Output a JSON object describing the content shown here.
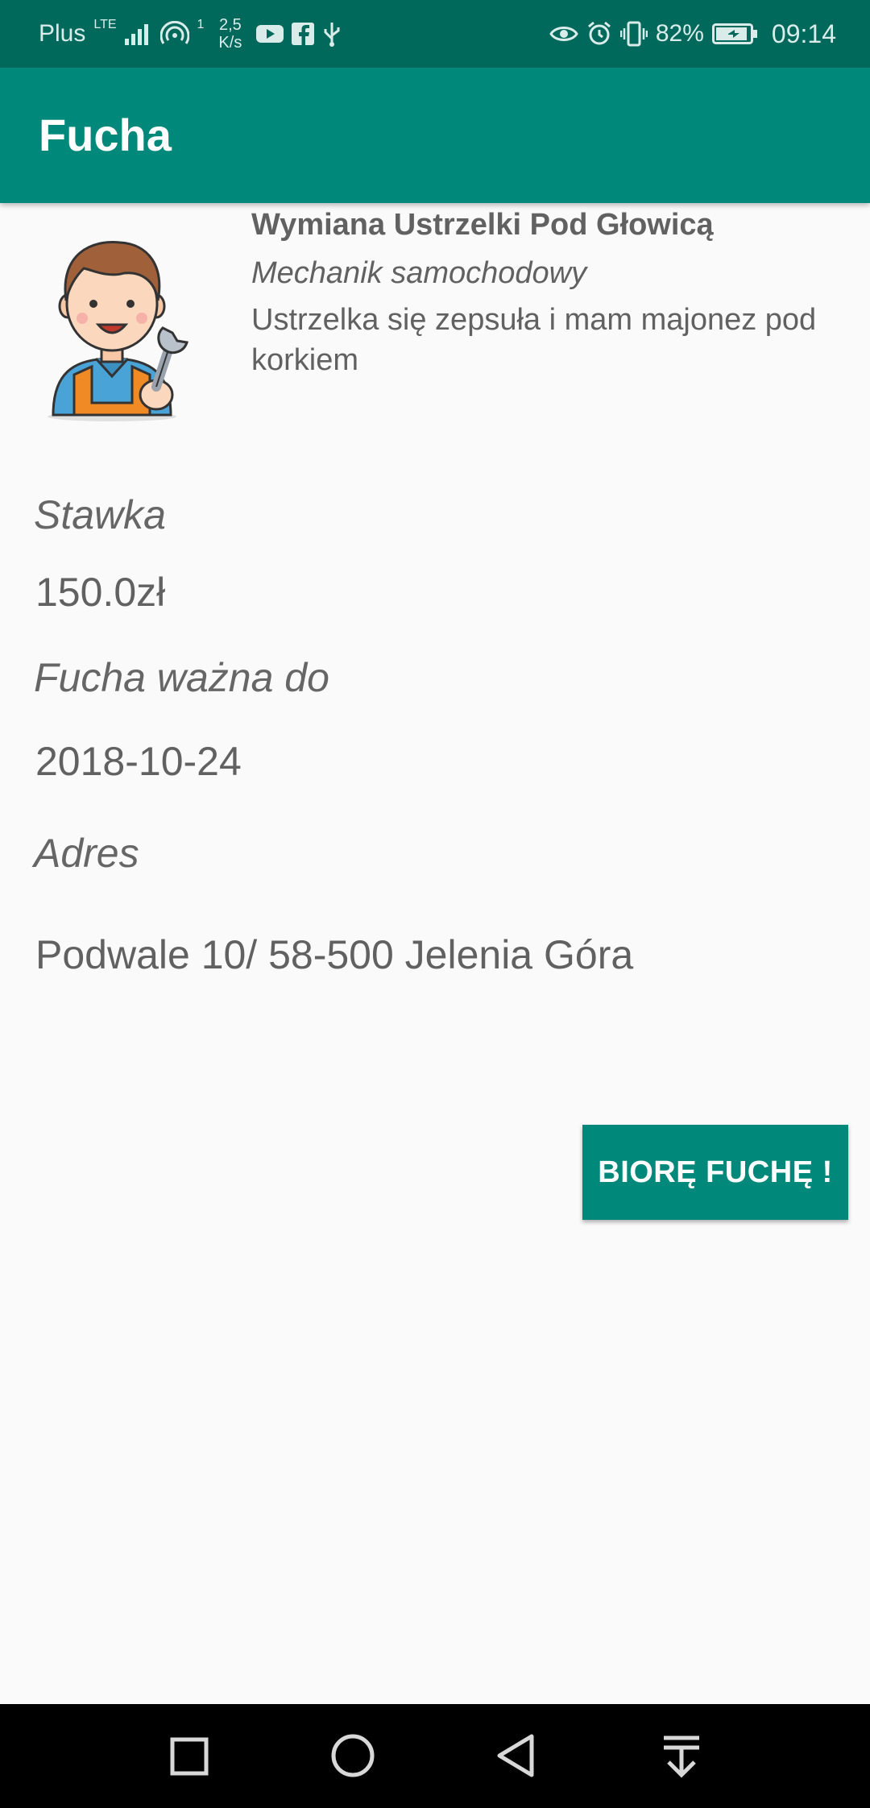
{
  "status_bar": {
    "carrier": "Plus",
    "network_type": "LTE",
    "wifi_badge": "1",
    "speed_value": "2,5",
    "speed_unit": "K/s",
    "battery": "82%",
    "time": "09:14",
    "icons": [
      "signal-icon",
      "hotspot-icon",
      "youtube-icon",
      "facebook-icon",
      "usb-icon",
      "eye-icon",
      "alarm-icon",
      "vibrate-icon",
      "battery-icon"
    ]
  },
  "app_bar": {
    "title": "Fucha"
  },
  "job": {
    "title": "Wymiana Ustrzelki Pod Głowicą",
    "category": "Mechanik samochodowy",
    "description": "Ustrzelka się zepsuła i mam majonez pod korkiem",
    "avatar_icon": "mechanic-avatar-icon"
  },
  "details": {
    "rate_label": "Stawka",
    "rate_value": "150.0zł",
    "valid_label": "Fucha ważna do",
    "valid_value": "2018-10-24",
    "address_label": "Adres",
    "address_value": "Podwale 10/ 58-500 Jelenia Góra"
  },
  "actions": {
    "take_button": "BIORĘ FUCHĘ !"
  },
  "nav_bar": {
    "buttons": [
      "recents-icon",
      "home-icon",
      "back-icon",
      "notifications-pulldown-icon"
    ]
  },
  "colors": {
    "status_bar": "#00695c",
    "primary": "#00897b",
    "background": "#fafafa",
    "text": "#616161"
  }
}
